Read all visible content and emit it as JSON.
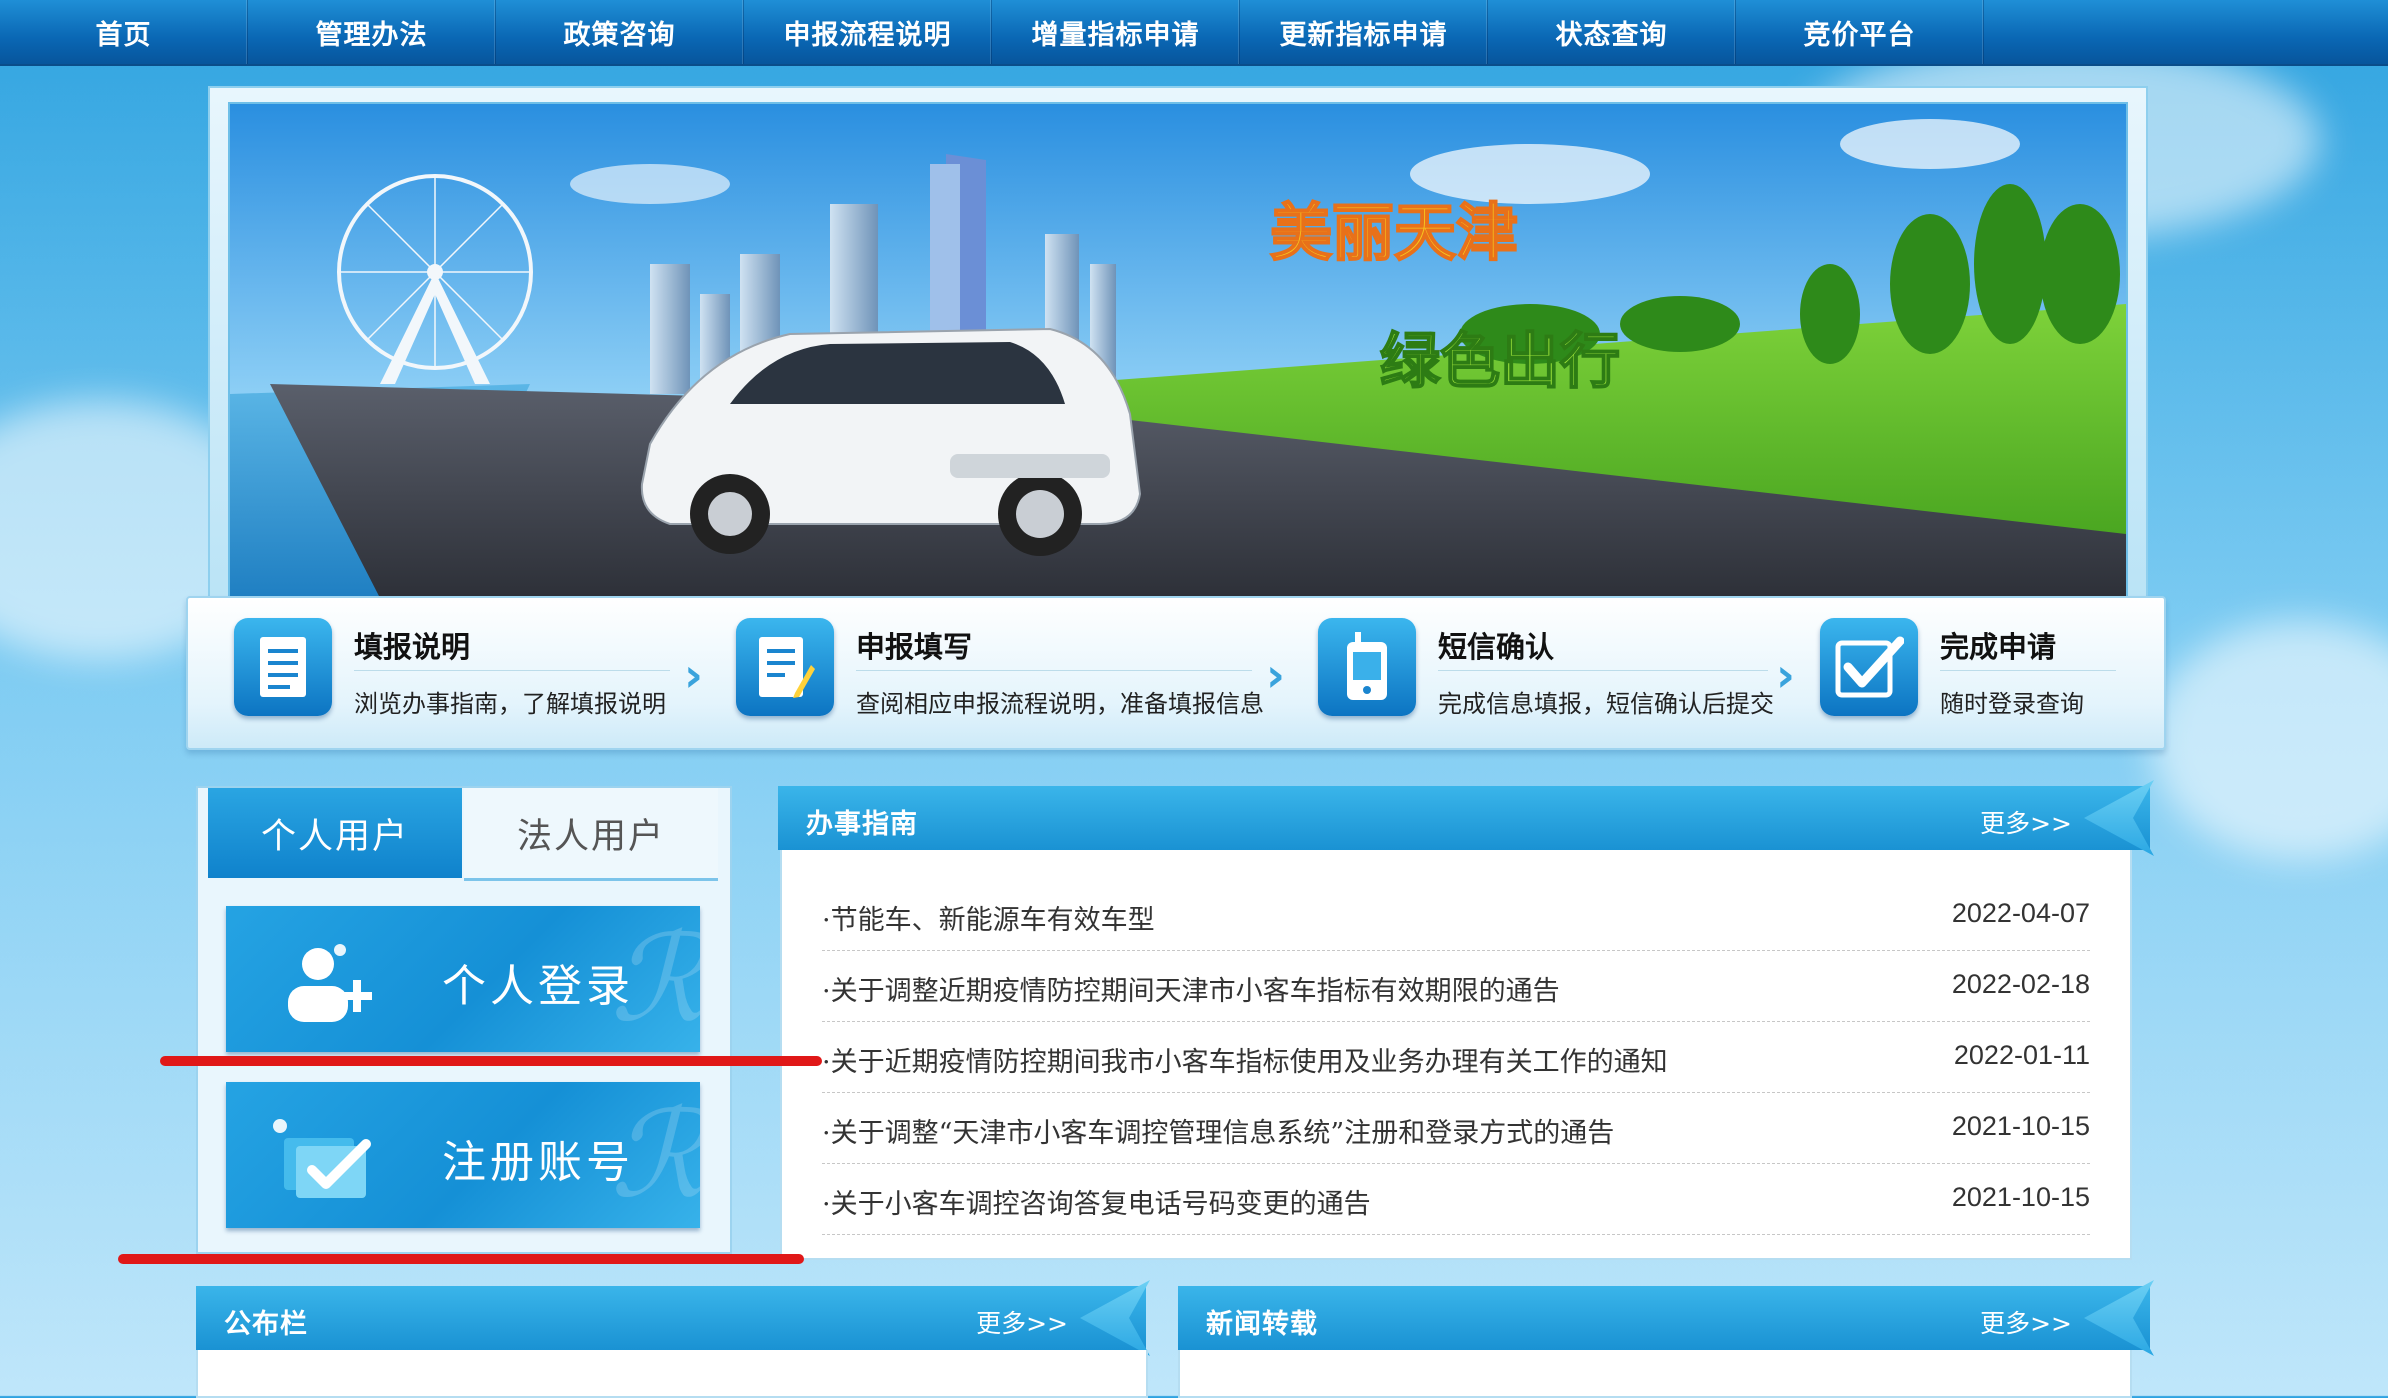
{
  "nav": {
    "items": [
      "首页",
      "管理办法",
      "政策咨询",
      "申报流程说明",
      "增量指标申请",
      "更新指标申请",
      "状态查询",
      "竞价平台"
    ]
  },
  "banner": {
    "headline": "美丽天津",
    "slogan": "绿色出行"
  },
  "steps": [
    {
      "title": "填报说明",
      "desc": "浏览办事指南，了解填报说明",
      "icon": "document-icon"
    },
    {
      "title": "申报填写",
      "desc": "查阅相应申报流程说明，准备填报信息",
      "icon": "edit-form-icon"
    },
    {
      "title": "短信确认",
      "desc": "完成信息填报，短信确认后提交",
      "icon": "mobile-phone-icon"
    },
    {
      "title": "完成申请",
      "desc": "随时登录查询",
      "icon": "checkmark-icon"
    }
  ],
  "login": {
    "tab_personal": "个人用户",
    "tab_corporate": "法人用户",
    "login_button": "个人登录",
    "register_button": "注册账号"
  },
  "guide": {
    "title": "办事指南",
    "more": "更多>>",
    "items": [
      {
        "title": "节能车、新能源车有效车型",
        "date": "2022-04-07"
      },
      {
        "title": "关于调整近期疫情防控期间天津市小客车指标有效期限的通告",
        "date": "2022-02-18"
      },
      {
        "title": "关于近期疫情防控期间我市小客车指标使用及业务办理有关工作的通知",
        "date": "2022-01-11"
      },
      {
        "title": "关于调整“天津市小客车调控管理信息系统”注册和登录方式的通告",
        "date": "2021-10-15"
      },
      {
        "title": "关于小客车调控咨询答复电话号码变更的通告",
        "date": "2021-10-15"
      }
    ]
  },
  "bulletin": {
    "title": "公布栏",
    "more": "更多>>"
  },
  "news": {
    "title": "新闻转载",
    "more": "更多>>"
  },
  "colors": {
    "nav_bg": "#0a67b4",
    "accent": "#1a92d3",
    "annotation_red": "#e01818"
  }
}
